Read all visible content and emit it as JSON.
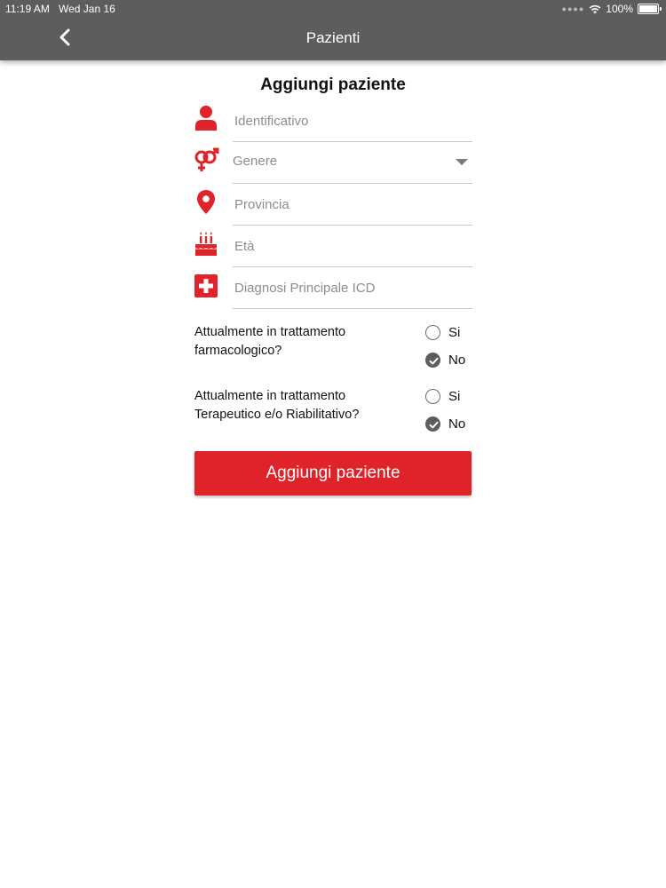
{
  "status_bar": {
    "time": "11:19 AM",
    "date": "Wed Jan 16",
    "battery": "100%"
  },
  "header": {
    "title": "Pazienti",
    "back_icon": "chevron-left-icon"
  },
  "form": {
    "title": "Aggiungi paziente",
    "fields": [
      {
        "icon": "person-icon",
        "placeholder": "Identificativo",
        "type": "text"
      },
      {
        "icon": "gender-icon",
        "placeholder": "Genere",
        "type": "select"
      },
      {
        "icon": "location-pin-icon",
        "placeholder": "Provincia",
        "type": "text"
      },
      {
        "icon": "birthday-cake-icon",
        "placeholder": "Età",
        "type": "text"
      },
      {
        "icon": "medical-cross-icon",
        "placeholder": "Diagnosi Principale ICD",
        "type": "text"
      }
    ],
    "questions": [
      {
        "label": "Attualmente in trattamento farmacologico?",
        "options": [
          {
            "label": "Si",
            "checked": false
          },
          {
            "label": "No",
            "checked": true
          }
        ]
      },
      {
        "label": "Attualmente in trattamento Terapeutico e/o Riabilitativo?",
        "options": [
          {
            "label": "Si",
            "checked": false
          },
          {
            "label": "No",
            "checked": true
          }
        ]
      }
    ],
    "submit_label": "Aggiungi paziente"
  },
  "colors": {
    "accent": "#e0232a",
    "header_bg": "#5d5d5d"
  }
}
